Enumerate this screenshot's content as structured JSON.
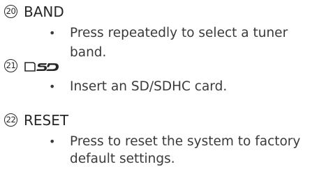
{
  "items": [
    {
      "number": "20",
      "heading": "BAND",
      "icon": null,
      "text": "Press repeatedly to select a tuner band."
    },
    {
      "number": "21",
      "heading": "",
      "icon": "sd-card-logo-icon",
      "text": "Insert an SD/SDHC card."
    },
    {
      "number": "22",
      "heading": "RESET",
      "icon": null,
      "text_lines": [
        "Press to reset the system to factory",
        "default settings."
      ]
    }
  ],
  "bullet": "•"
}
